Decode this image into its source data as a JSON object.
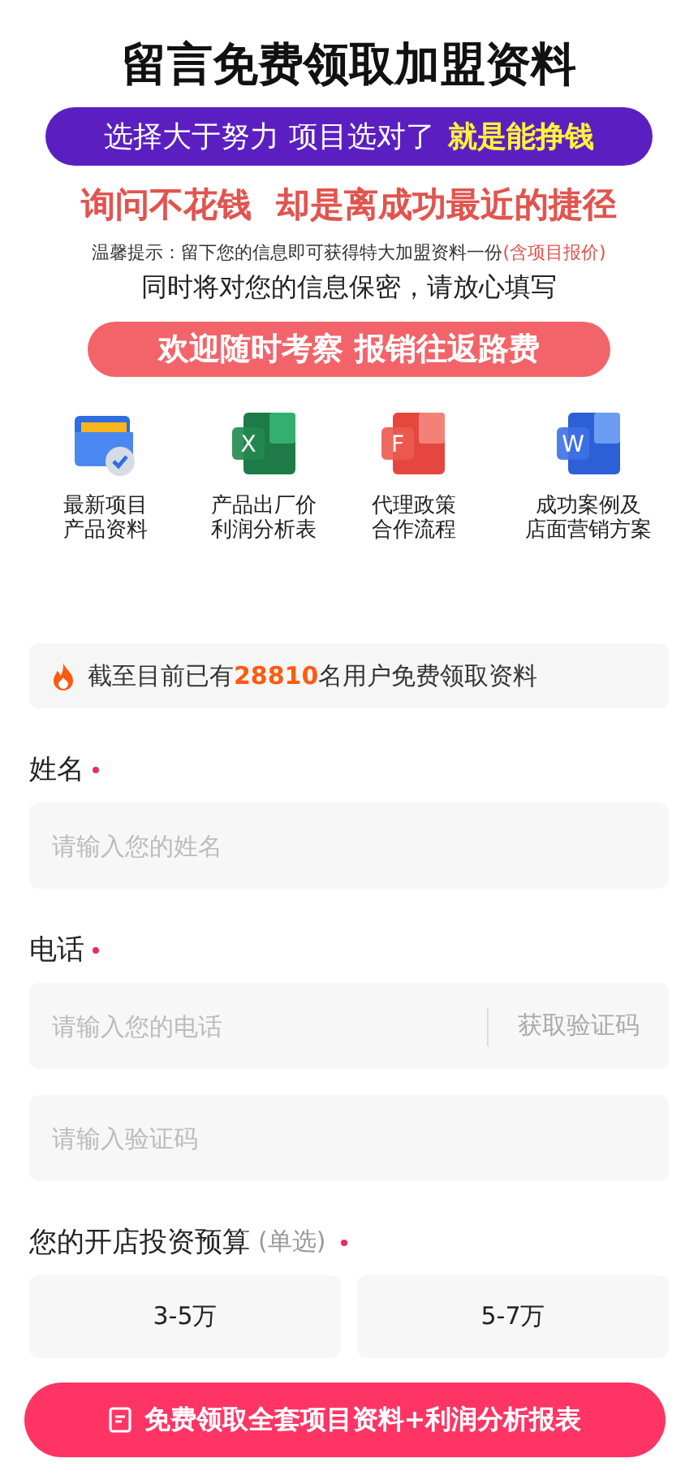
{
  "title": "留言免费领取加盟资料",
  "slogan": {
    "text": "选择大于努力 项目选对了",
    "highlight": "就是能挣钱"
  },
  "subtitle": "询问不花钱  却是离成功最近的捷径",
  "tip": {
    "text": "温馨提示：留下您的信息即可获得特大加盟资料一份",
    "highlight": "(含项目报价)"
  },
  "privacy": "同时将对您的信息保密，请放心填写",
  "visit_banner": "欢迎随时考察 报销往返路费",
  "resources": [
    {
      "kind": "folder",
      "lines": [
        "最新项目",
        "产品资料"
      ]
    },
    {
      "kind": "sheet",
      "letter": "X",
      "lines": [
        "产品出厂价",
        "利润分析表"
      ]
    },
    {
      "kind": "pdf",
      "letter": "F",
      "lines": [
        "代理政策",
        "合作流程"
      ]
    },
    {
      "kind": "doc",
      "letter": "W",
      "lines": [
        "成功案例及",
        "店面营销方案"
      ]
    }
  ],
  "notice": {
    "before": "截至目前已有",
    "count": "28810",
    "after": "名用户免费领取资料"
  },
  "fields": [
    {
      "kind": "text",
      "label": "姓名",
      "required": true,
      "placeholder": "请输入您的姓名"
    },
    {
      "kind": "phone",
      "label": "电话",
      "required": true,
      "placeholder": "请输入您的电话",
      "action": "获取验证码"
    },
    {
      "kind": "code",
      "placeholder": "请输入验证码"
    }
  ],
  "budget": {
    "label": "您的开店投资预算",
    "hint": "(单选)",
    "required": true,
    "options": [
      {
        "label": "3-5万",
        "selected": false
      },
      {
        "label": "5-7万",
        "selected": false
      }
    ]
  },
  "submit": "免费领取全套项目资料+利润分析报表"
}
